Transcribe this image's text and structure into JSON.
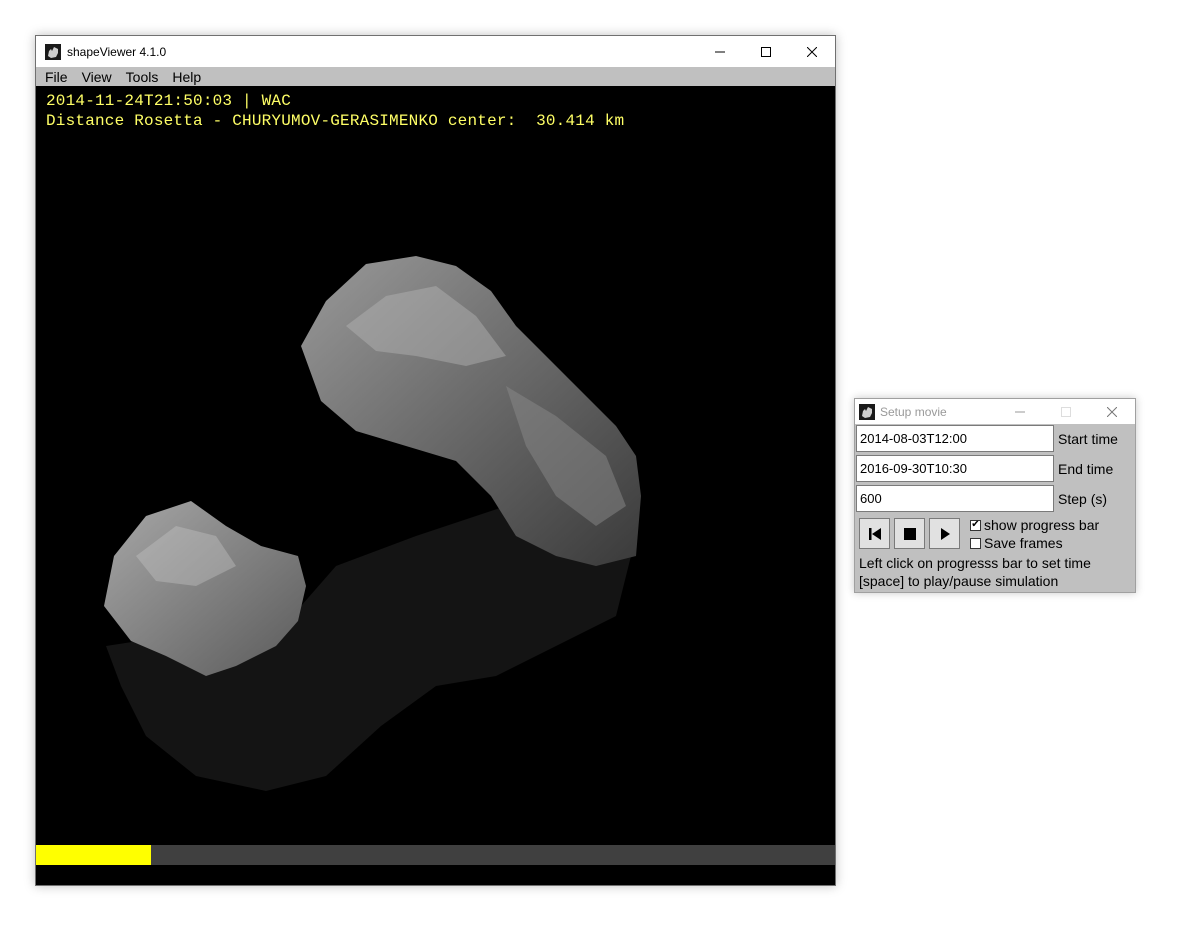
{
  "main_window": {
    "title": "shapeViewer 4.1.0",
    "menu": [
      "File",
      "View",
      "Tools",
      "Help"
    ],
    "overlay": {
      "line1": "2014-11-24T21:50:03 | WAC",
      "line2": "Distance Rosetta - CHURYUMOV-GERASIMENKO center:  30.414 km"
    },
    "progress_fraction": 0.144,
    "colors": {
      "overlay_text": "#ffff66",
      "progress_fill": "#ffff00",
      "progress_track": "#404040"
    }
  },
  "setup_window": {
    "title": "Setup movie",
    "start_time": {
      "value": "2014-08-03T12:00",
      "label": "Start time"
    },
    "end_time": {
      "value": "2016-09-30T10:30",
      "label": "End time"
    },
    "step": {
      "value": "600",
      "label": "Step (s)"
    },
    "show_progress_bar": {
      "label": "show progress bar",
      "checked": true
    },
    "save_frames": {
      "label": "Save frames",
      "checked": false
    },
    "hint1": "Left click on progresss bar to set time",
    "hint2": "[space] to play/pause simulation",
    "buttons": [
      "skip-to-start-icon",
      "stop-icon",
      "play-icon"
    ]
  }
}
